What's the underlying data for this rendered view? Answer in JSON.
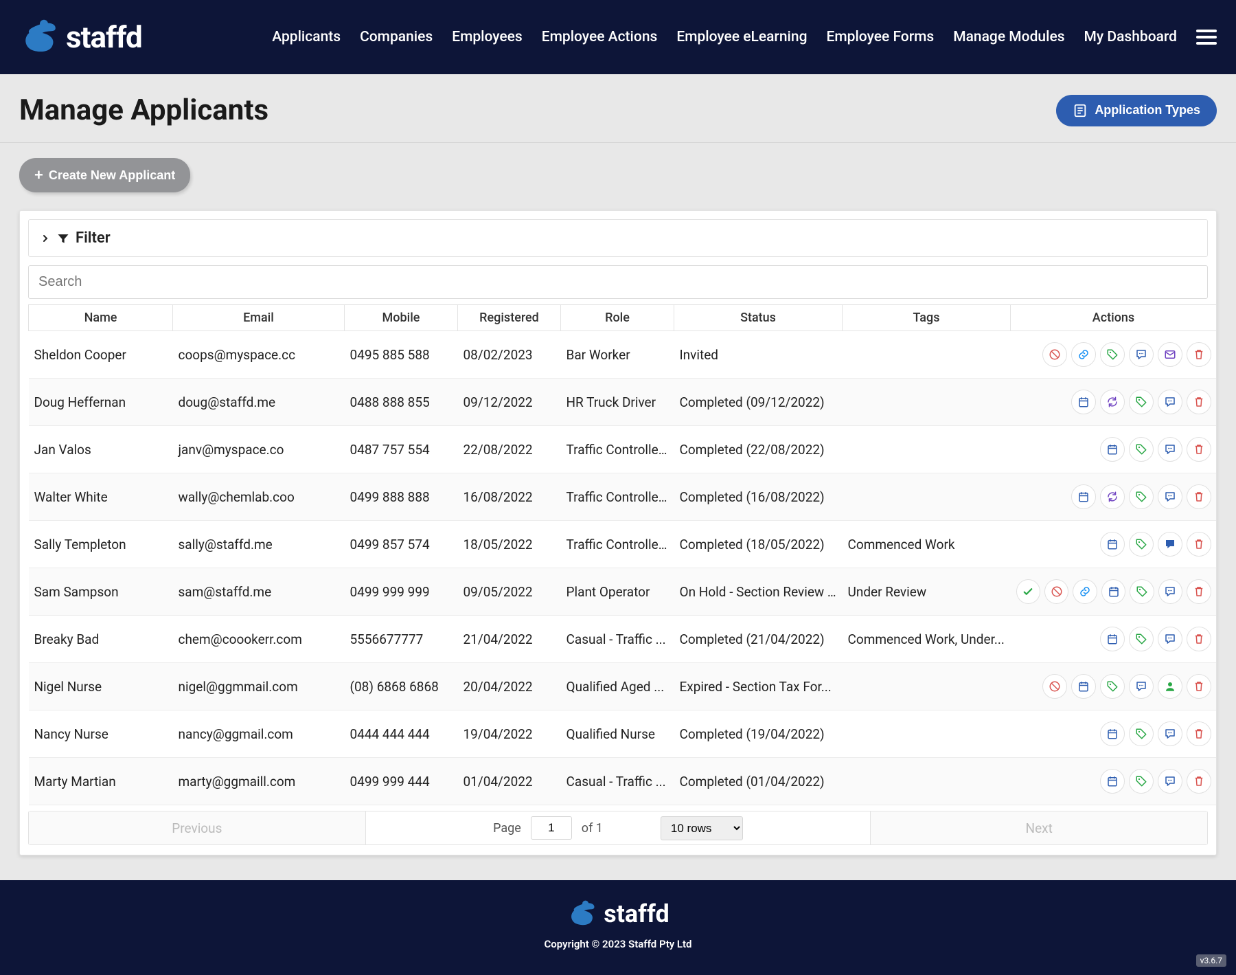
{
  "brand": "staffd",
  "nav": [
    "Applicants",
    "Companies",
    "Employees",
    "Employee Actions",
    "Employee eLearning",
    "Employee Forms",
    "Manage Modules",
    "My Dashboard"
  ],
  "page": {
    "title": "Manage Applicants",
    "app_types_btn": "Application Types",
    "create_btn": "Create New Applicant",
    "filter_label": "Filter",
    "search_placeholder": "Search"
  },
  "columns": [
    "Name",
    "Email",
    "Mobile",
    "Registered",
    "Role",
    "Status",
    "Tags",
    "Actions"
  ],
  "rows": [
    {
      "name": "Sheldon Cooper",
      "email": "coops@myspace.cc",
      "mobile": "0495 885 588",
      "registered": "08/02/2023",
      "role": "Bar Worker",
      "status": "Invited",
      "tags": "",
      "actions": [
        "ban",
        "link",
        "tag",
        "chat",
        "mail",
        "trash"
      ]
    },
    {
      "name": "Doug Heffernan",
      "email": "doug@staffd.me",
      "mobile": "0488 888 855",
      "registered": "09/12/2022",
      "role": "HR Truck Driver",
      "status": "Completed (09/12/2022)",
      "tags": "",
      "actions": [
        "calendar",
        "refresh",
        "tag",
        "chat",
        "trash"
      ]
    },
    {
      "name": "Jan Valos",
      "email": "janv@myspace.co",
      "mobile": "0487 757 554",
      "registered": "22/08/2022",
      "role": "Traffic Controlle...",
      "status": "Completed (22/08/2022)",
      "tags": "",
      "actions": [
        "calendar",
        "tag",
        "chat",
        "trash"
      ]
    },
    {
      "name": "Walter White",
      "email": "wally@chemlab.coo",
      "mobile": "0499 888 888",
      "registered": "16/08/2022",
      "role": "Traffic Controlle...",
      "status": "Completed (16/08/2022)",
      "tags": "",
      "actions": [
        "calendar",
        "refresh",
        "tag",
        "chat",
        "trash"
      ]
    },
    {
      "name": "Sally Templeton",
      "email": "sally@staffd.me",
      "mobile": "0499 857 574",
      "registered": "18/05/2022",
      "role": "Traffic Controlle...",
      "status": "Completed (18/05/2022)",
      "tags": "Commenced Work",
      "actions": [
        "calendar",
        "tag",
        "chat-fill",
        "trash"
      ]
    },
    {
      "name": "Sam Sampson",
      "email": "sam@staffd.me",
      "mobile": "0499 999 999",
      "registered": "09/05/2022",
      "role": "Plant Operator",
      "status": "On Hold - Section Review ...",
      "tags": "Under Review",
      "actions": [
        "check",
        "ban",
        "link",
        "calendar",
        "tag",
        "chat",
        "trash"
      ]
    },
    {
      "name": "Breaky Bad",
      "email": "chem@coookerr.com",
      "mobile": "5556677777",
      "registered": "21/04/2022",
      "role": "Casual - Traffic ...",
      "status": "Completed (21/04/2022)",
      "tags": "Commenced Work, Under...",
      "actions": [
        "calendar",
        "tag",
        "chat",
        "trash"
      ]
    },
    {
      "name": "Nigel Nurse",
      "email": "nigel@ggmmail.com",
      "mobile": "(08) 6868 6868",
      "registered": "20/04/2022",
      "role": "Qualified Aged ...",
      "status": "Expired - Section Tax For...",
      "tags": "",
      "actions": [
        "ban",
        "calendar",
        "tag",
        "chat",
        "user",
        "trash"
      ]
    },
    {
      "name": "Nancy Nurse",
      "email": "nancy@ggmail.com",
      "mobile": "0444 444 444",
      "registered": "19/04/2022",
      "role": "Qualified Nurse",
      "status": "Completed (19/04/2022)",
      "tags": "",
      "actions": [
        "calendar",
        "tag",
        "chat",
        "trash"
      ]
    },
    {
      "name": "Marty Martian",
      "email": "marty@ggmaill.com",
      "mobile": "0499 999 444",
      "registered": "01/04/2022",
      "role": "Casual - Traffic ...",
      "status": "Completed (01/04/2022)",
      "tags": "",
      "actions": [
        "calendar",
        "tag",
        "chat",
        "trash"
      ]
    }
  ],
  "pagination": {
    "previous": "Previous",
    "next": "Next",
    "page_label": "Page",
    "page": "1",
    "of_label": "of 1",
    "rows_label": "10 rows"
  },
  "footer": {
    "copyright": "Copyright © 2023 Staffd Pty Ltd",
    "version": "v3.6.7"
  },
  "icons": {
    "ban": {
      "color": "c-red"
    },
    "link": {
      "color": "c-blue2"
    },
    "tag": {
      "color": "c-green"
    },
    "chat": {
      "color": "c-blue"
    },
    "chat-fill": {
      "color": "c-blue"
    },
    "mail": {
      "color": "c-purple"
    },
    "trash": {
      "color": "c-red"
    },
    "calendar": {
      "color": "c-blue"
    },
    "refresh": {
      "color": "c-purple"
    },
    "check": {
      "color": "c-green"
    },
    "user": {
      "color": "c-green"
    }
  }
}
